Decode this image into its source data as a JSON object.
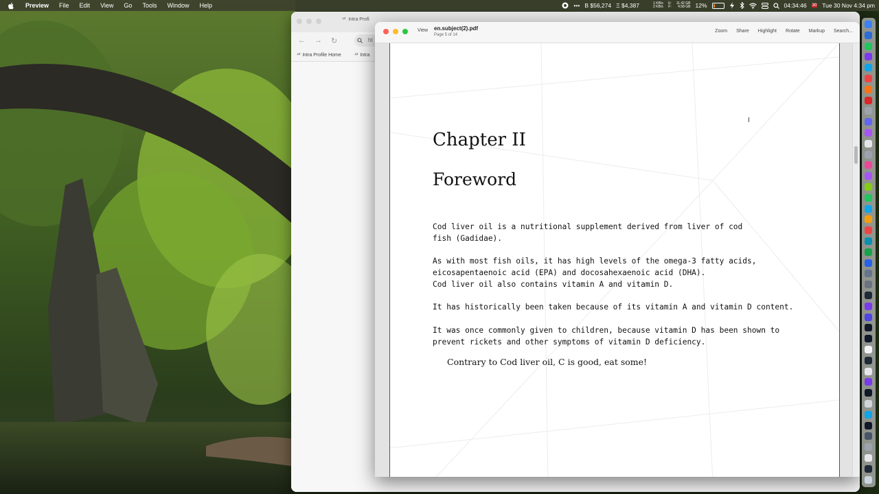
{
  "menubar": {
    "app": "Preview",
    "items": [
      "File",
      "Edit",
      "View",
      "Go",
      "Tools",
      "Window",
      "Help"
    ],
    "status": {
      "more": "•••",
      "btc": "B $56,274",
      "eth": "Ξ $4,387",
      "net_up": "1 KB/s",
      "net_down": "2 KB/s",
      "mem_u": "U:",
      "mem_f": "F:",
      "mem_used": "11.42 GB",
      "mem_free": "4.58 GB",
      "battery_pct": "12%",
      "battery_level": 0.12,
      "clock": "04:34:46",
      "cal_day": "30",
      "datetime": "Tue 30 Nov  4:34 pm"
    }
  },
  "browser": {
    "tab_label": "Intra Profi",
    "url_text": "ht",
    "bookmarks": [
      "Intra Profile Home",
      "Intra"
    ]
  },
  "preview": {
    "view_label": "View",
    "doc_title": "en.subject(2).pdf",
    "page_info": "Page 5 of 14",
    "toolbar": [
      "Zoom",
      "Share",
      "Highlight",
      "Rotate",
      "Markup",
      "Search..."
    ]
  },
  "document": {
    "chapter": "Chapter II",
    "heading": "Foreword",
    "paragraphs": [
      "Cod liver oil is a nutritional supplement derived from liver of cod\nfish (Gadidae).",
      "As with most fish oils, it has high levels of the omega-3 fatty acids,\neicosapentaenoic acid (EPA) and docosahexaenoic acid (DHA).\nCod liver oil also contains vitamin A and vitamin D.",
      "It has historically been taken because of its vitamin A and vitamin D content.",
      "It was once commonly given to children, because vitamin D has been shown to\nprevent rickets and other symptoms of vitamin D deficiency."
    ],
    "quote": "Contrary to Cod liver oil, C is good, eat some!"
  },
  "dock": {
    "icon_colors": [
      "#3b82f6",
      "#2b6fd6",
      "#22c55e",
      "#7c3aed",
      "#0ea5e9",
      "#ef4444",
      "#f97316",
      "#dc2626",
      "#9ca3af",
      "#6366f1",
      "#a855f7",
      "#e5e7eb",
      "#9ca3af",
      "#ec4899",
      "#a855f7",
      "#84cc16",
      "#22c55e",
      "#0ea5e9",
      "#f59e0b",
      "#ef4444",
      "#0891b2",
      "#16a34a",
      "#2563eb",
      "#64748b",
      "#6b7280",
      "#1f2937",
      "#7c3aed",
      "#4f46e5",
      "#111827",
      "#0f172a",
      "#f3f4f6",
      "#1f2937",
      "#e5e7eb",
      "#7c3aed",
      "#111827",
      "#d1d5db",
      "#0ea5e9",
      "#111827",
      "#475569",
      "#9ca3af",
      "#e5e7eb",
      "#1f2937",
      "#cbd5e1"
    ]
  }
}
